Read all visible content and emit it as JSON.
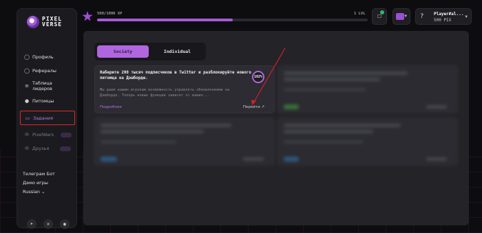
{
  "sidebar": {
    "logo_line1": "PIXEL",
    "logo_line2": "VERSE",
    "items": [
      {
        "label": "Профиль",
        "icon": "user-icon"
      },
      {
        "label": "Рефералы",
        "icon": "users-icon"
      },
      {
        "label": "Таблица лидеров",
        "icon": "list-icon"
      },
      {
        "label": "Питомцы",
        "icon": "pet-icon"
      },
      {
        "label": "Задания",
        "icon": "clipboard-icon"
      },
      {
        "label": "PixelWars",
        "icon": "shield-icon"
      },
      {
        "label": "Друзья",
        "icon": "friends-icon"
      }
    ],
    "links": {
      "telegram_bot": "Телеграм Бот",
      "game_demo": "Демо игры",
      "language": "Russian"
    }
  },
  "header": {
    "xp_text": "500/1000 XP",
    "level_text": "1 LVL",
    "xp_progress": 0.5,
    "player_name": "Player#al...",
    "player_balance": "500 PIX"
  },
  "main": {
    "tabs": [
      {
        "label": "Society",
        "active": true
      },
      {
        "label": "Individual",
        "active": false
      }
    ],
    "task": {
      "title": "Наберите 200 тысяч подписчиков в Twitter и разблокируйте нового питомца на Дэшборде.",
      "description": "Мы даем нашим игрокам возможность управлять обновлениями на Дэшборде. Теперь новые функции зависят от ваших...",
      "progress": "102%",
      "more_label": "Подробнее",
      "go_label": "Перейти"
    }
  },
  "colors": {
    "accent": "#b066de",
    "highlight": "#e0282e",
    "annotation_arrow": "#d61f2c"
  }
}
